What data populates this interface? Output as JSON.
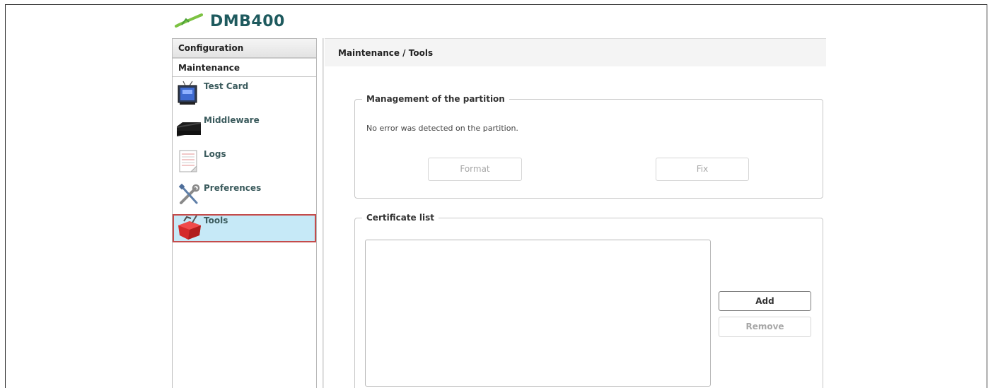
{
  "app": {
    "title": "DMB400"
  },
  "sidebar": {
    "sections": [
      {
        "label": "Configuration"
      },
      {
        "label": "Maintenance"
      }
    ],
    "items": [
      {
        "label": "Test Card",
        "icon": "tv-icon"
      },
      {
        "label": "Middleware",
        "icon": "set-top-box-icon"
      },
      {
        "label": "Logs",
        "icon": "log-document-icon"
      },
      {
        "label": "Preferences",
        "icon": "tools-wrench-icon"
      },
      {
        "label": "Tools",
        "icon": "toolbox-icon",
        "selected": true
      }
    ]
  },
  "main": {
    "breadcrumb": "Maintenance / Tools",
    "partition": {
      "legend": "Management of the partition",
      "message": "No error was detected on the partition.",
      "format_label": "Format",
      "fix_label": "Fix"
    },
    "certificates": {
      "legend": "Certificate list",
      "items": [],
      "add_label": "Add",
      "remove_label": "Remove"
    }
  },
  "colors": {
    "brand": "#1e5a5e",
    "selected_bg": "#c6e9f7",
    "selected_border": "#c44b4b"
  }
}
